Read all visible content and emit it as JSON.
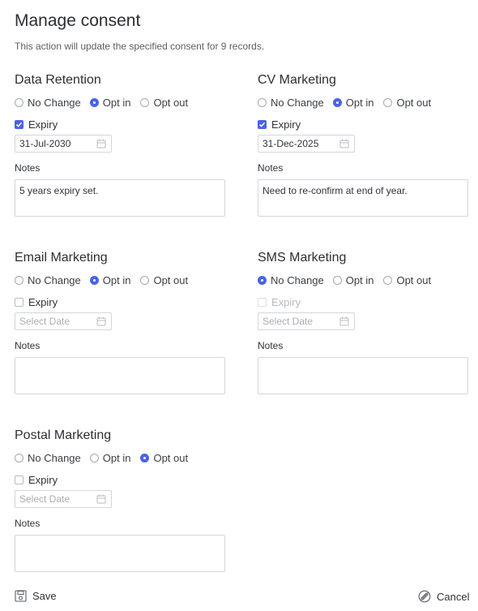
{
  "dialog": {
    "title": "Manage consent",
    "subtitle": "This action will update the specified consent for 9 records."
  },
  "sections": [
    {
      "title": "Data Retention",
      "options": [
        "No Change",
        "Opt in",
        "Opt out"
      ],
      "selected": "Opt in",
      "expiry_label": "Expiry",
      "expiry_checked": true,
      "expiry_disabled": false,
      "date_value": "31-Jul-2030",
      "date_placeholder": "",
      "notes_label": "Notes",
      "notes_value": "5 years expiry set."
    },
    {
      "title": "CV Marketing",
      "options": [
        "No Change",
        "Opt in",
        "Opt out"
      ],
      "selected": "Opt in",
      "expiry_label": "Expiry",
      "expiry_checked": true,
      "expiry_disabled": false,
      "date_value": "31-Dec-2025",
      "date_placeholder": "",
      "notes_label": "Notes",
      "notes_value": "Need to re-confirm at end of year."
    },
    {
      "title": "Email Marketing",
      "options": [
        "No Change",
        "Opt in",
        "Opt out"
      ],
      "selected": "Opt in",
      "expiry_label": "Expiry",
      "expiry_checked": false,
      "expiry_disabled": false,
      "date_value": "",
      "date_placeholder": "Select Date",
      "notes_label": "Notes",
      "notes_value": ""
    },
    {
      "title": "SMS Marketing",
      "options": [
        "No Change",
        "Opt in",
        "Opt out"
      ],
      "selected": "No Change",
      "expiry_label": "Expiry",
      "expiry_checked": false,
      "expiry_disabled": true,
      "date_value": "",
      "date_placeholder": "Select Date",
      "notes_label": "Notes",
      "notes_value": ""
    },
    {
      "title": "Postal Marketing",
      "options": [
        "No Change",
        "Opt in",
        "Opt out"
      ],
      "selected": "Opt out",
      "expiry_label": "Expiry",
      "expiry_checked": false,
      "expiry_disabled": false,
      "date_value": "",
      "date_placeholder": "Select Date",
      "notes_label": "Notes",
      "notes_value": ""
    }
  ],
  "footer": {
    "save_label": "Save",
    "cancel_label": "Cancel"
  },
  "colors": {
    "accent": "#4a63e6",
    "border": "#d3d6da",
    "text": "#2f3338"
  },
  "icons": {
    "date_field": "calendar-icon",
    "save": "save-icon",
    "cancel": "cancel-icon"
  }
}
